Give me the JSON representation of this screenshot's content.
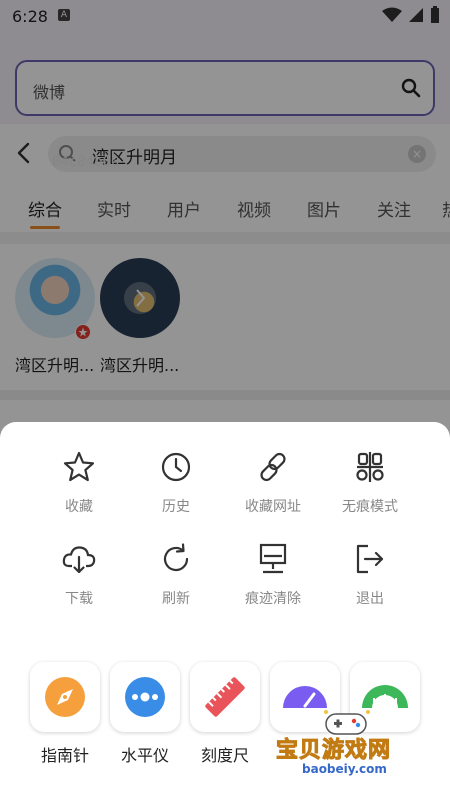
{
  "status_bar": {
    "time": "6:28",
    "notification_glyph": "A"
  },
  "top_search": {
    "value": "微博"
  },
  "results_header": {
    "query": "湾区升明月",
    "overlay_code": "04c84b00",
    "tabs": [
      {
        "label": "综合",
        "active": true
      },
      {
        "label": "实时",
        "active": false
      },
      {
        "label": "用户",
        "active": false
      },
      {
        "label": "视频",
        "active": false
      },
      {
        "label": "图片",
        "active": false
      },
      {
        "label": "关注",
        "active": false
      },
      {
        "label": "热",
        "active": false
      }
    ]
  },
  "users": [
    {
      "name": "湾区升明...",
      "verified_badge": true
    },
    {
      "name": "湾区升明..."
    }
  ],
  "menu": {
    "row1": [
      {
        "label": "收藏",
        "icon": "star-icon"
      },
      {
        "label": "历史",
        "icon": "clock-icon"
      },
      {
        "label": "收藏网址",
        "icon": "link-icon"
      },
      {
        "label": "无痕模式",
        "icon": "incognito-icon"
      }
    ],
    "row2": [
      {
        "label": "下载",
        "icon": "cloud-download-icon"
      },
      {
        "label": "刷新",
        "icon": "refresh-icon"
      },
      {
        "label": "痕迹清除",
        "icon": "clear-trace-icon"
      },
      {
        "label": "退出",
        "icon": "exit-icon"
      }
    ]
  },
  "tools": [
    {
      "label": "指南针",
      "icon": "compass-icon",
      "color": "#f5a03c"
    },
    {
      "label": "水平仪",
      "icon": "level-icon",
      "color": "#3a8de6"
    },
    {
      "label": "刻度尺",
      "icon": "ruler-icon",
      "color": "#e9545a"
    },
    {
      "label": "",
      "icon": "gauge-icon",
      "color": "#7a5cf0"
    },
    {
      "label": "",
      "icon": "speedometer-icon",
      "color": "#3cb85a"
    }
  ],
  "watermark": {
    "title": "宝贝游戏网",
    "url": "baobeiy.com"
  },
  "colors": {
    "accent_orange": "#f08a2c",
    "search_border": "#6b62b0"
  }
}
